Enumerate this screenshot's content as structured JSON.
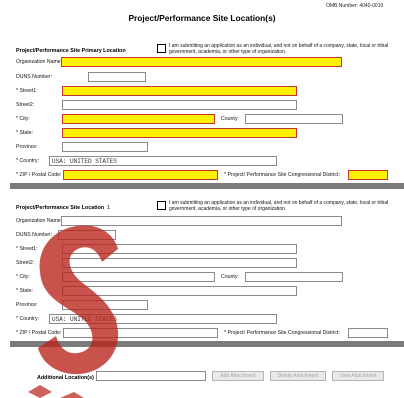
{
  "header": {
    "omb": "OMB Number: 4040-0010",
    "title": "Project/Performance Site Location(s)"
  },
  "primary": {
    "section_title": "Project/Performance Site Primary Location",
    "checkbox_note": "I am submitting an application as an individual, and not on behalf of a company, state, local or tribal government, academia, or other type of organization.",
    "labels": {
      "org": "Organization Name:",
      "duns": "DUNS Number:",
      "street1": "* Street1:",
      "street2": "Street2:",
      "city": "* City:",
      "county": "County:",
      "state": "* State:",
      "province": "Province:",
      "country": "* Country:",
      "zip": "* ZIP / Postal Code:",
      "district": "* Project/ Performance Site Congressional District:"
    },
    "country_value": "USA: UNITED STATES"
  },
  "location1": {
    "section_title": "Project/Performance Site Location",
    "number": "1",
    "checkbox_note": "I am submitting an application as an individual, and not on behalf of a company, state, local or tribal government, academia, or other type of organization.",
    "labels": {
      "org": "Organization Name:",
      "duns": "DUNS Number:",
      "street1": "* Street1:",
      "street2": "Street2:",
      "city": "* City:",
      "county": "County:",
      "state": "* State:",
      "province": "Province:",
      "country": "* Country:",
      "zip": "* ZIP / Postal Code:",
      "district": "* Project/ Performance Site Congressional District:"
    },
    "country_value": "USA: UNITED STATES"
  },
  "additional": {
    "label": "Additional Location(s)",
    "add": "Add Attachment",
    "delete": "Delete Attachment",
    "view": "View Attachment"
  },
  "colors": {
    "required_fill": "#fff200",
    "required_border": "#c8322f",
    "separator": "#7b7b7b",
    "watermark": "#b8231a"
  }
}
